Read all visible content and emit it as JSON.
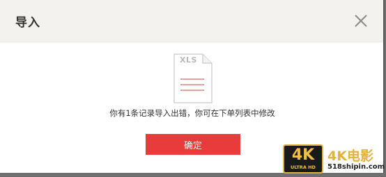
{
  "dialog": {
    "title": "导入",
    "close_icon": "close-icon",
    "file_icon": "xls-file-icon",
    "file_ext": "XLS",
    "message": "你有1条记录导入出错，你可在下单列表中修改",
    "confirm_label": "确定",
    "accent_color": "#e83c3c",
    "header_bg": "#f4f2ee"
  },
  "watermark": {
    "badge_main": "4K",
    "badge_sub": "ULTRA HD",
    "title": "4K电影",
    "site": "518shipin.com"
  }
}
